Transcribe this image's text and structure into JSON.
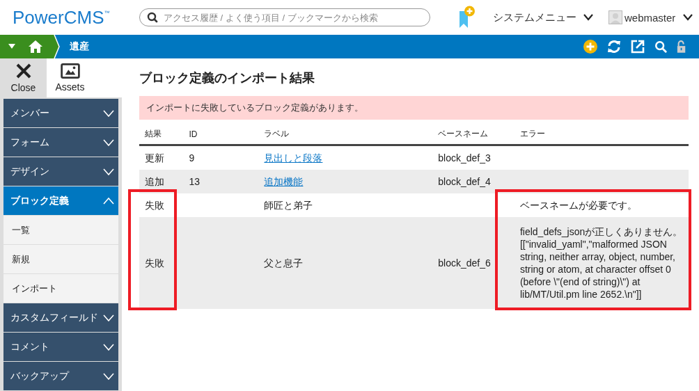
{
  "header": {
    "logo": "PowerCMS",
    "logo_mark": "™",
    "search": {
      "placeholder": "アクセス履歴 / よく使う項目 / ブックマークから検索"
    },
    "system_menu": "システムメニュー",
    "user": "webmaster"
  },
  "breadcrumb": {
    "site": "遺産"
  },
  "tools": [
    {
      "label": "Close",
      "kind": "close",
      "selected": true
    },
    {
      "label": "Assets",
      "kind": "assets",
      "selected": false
    }
  ],
  "sidebar": {
    "items": [
      {
        "label": "メンバー",
        "expanded": false
      },
      {
        "label": "フォーム",
        "expanded": false
      },
      {
        "label": "デザイン",
        "expanded": false
      },
      {
        "label": "ブロック定義",
        "expanded": true,
        "children": [
          {
            "label": "一覧"
          },
          {
            "label": "新規"
          },
          {
            "label": "インポート"
          }
        ]
      },
      {
        "label": "カスタムフィールド",
        "expanded": false
      },
      {
        "label": "コメント",
        "expanded": false
      },
      {
        "label": "バックアップ",
        "expanded": false
      }
    ]
  },
  "page": {
    "title": "ブロック定義のインポート結果",
    "alert": "インポートに失敗しているブロック定義があります。"
  },
  "table": {
    "columns": [
      {
        "label": "結果",
        "highlighted": true
      },
      {
        "label": "ID",
        "highlighted": false
      },
      {
        "label": "ラベル",
        "highlighted": false
      },
      {
        "label": "ベースネーム",
        "highlighted": false
      },
      {
        "label": "エラー",
        "highlighted": true
      }
    ],
    "rows": [
      {
        "result": "更新",
        "id": "9",
        "label": "見出しと段落",
        "label_link": true,
        "basename": "block_def_3",
        "highlighted": false
      },
      {
        "result": "追加",
        "id": "13",
        "label": "追加機能",
        "label_link": true,
        "basename": "block_def_4",
        "highlighted": false
      },
      {
        "result": "失敗",
        "label": "師匠と弟子",
        "label_link": false,
        "error": "ベースネームが必要です。",
        "highlighted": true
      },
      {
        "result": "失敗",
        "label": "父と息子",
        "label_link": false,
        "basename": "block_def_6",
        "error": "field_defs_jsonが正しくありません。[[\"invalid_yaml\",\"malformed JSON string, neither array, object, number, string or atom, at character offset 0 (before \\\"(end of string)\\\") at lib/MT/Util.pm line 2652.\\n\"]]",
        "highlighted": true
      }
    ]
  }
}
